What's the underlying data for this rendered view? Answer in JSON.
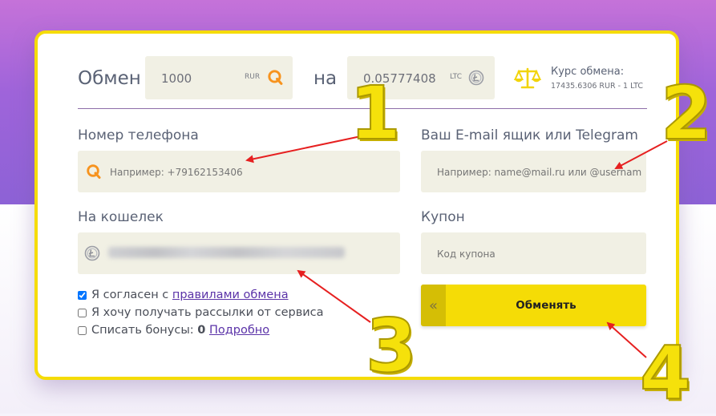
{
  "exchange": {
    "label": "Обмен",
    "give_amount": "1000",
    "give_currency": "RUR",
    "connector": "на",
    "get_amount": "0.05777408",
    "get_currency": "LTC",
    "rate_title": "Курс обмена:",
    "rate_value": "17435.6306 RUR - 1 LTC"
  },
  "phone": {
    "label": "Номер телефона",
    "placeholder": "Например: +79162153406"
  },
  "email": {
    "label": "Ваш E-mail ящик или Telegram",
    "placeholder": "Например: name@mail.ru или @username"
  },
  "wallet": {
    "label": "На кошелек"
  },
  "coupon": {
    "label": "Купон",
    "placeholder": "Код купона"
  },
  "agreements": {
    "rules_prefix": "Я согласен с",
    "rules_link": "правилами обмена",
    "rules_checked": true,
    "newsletter": "Я хочу получать рассылки от сервиса",
    "newsletter_checked": false,
    "bonus_prefix": "Списать бонусы:",
    "bonus_value": "0",
    "bonus_link": "Подробно",
    "bonus_checked": false
  },
  "submit": {
    "grip": "«",
    "label": "Обменять"
  },
  "annotations": {
    "n1": "1",
    "n2": "2",
    "n3": "3",
    "n4": "4",
    "color": "#e62020"
  },
  "colors": {
    "accent_yellow": "#f5dc06",
    "field_bg": "#f1f0e4",
    "qiwi_orange": "#f7931e",
    "link_purple": "#5b33a8"
  }
}
